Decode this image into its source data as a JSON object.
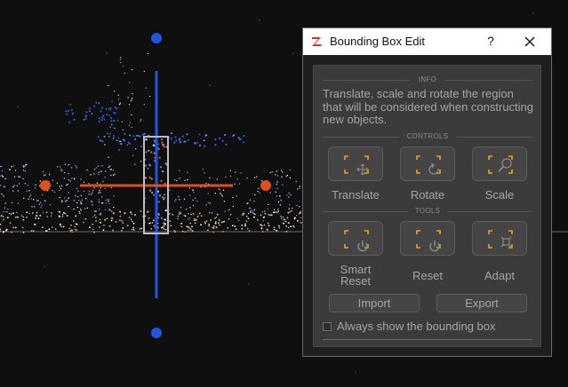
{
  "window": {
    "title": "Bounding Box Edit",
    "help_label": "?"
  },
  "info": {
    "header": "INFO",
    "text": "Translate, scale and rotate the region that will be considered when constructing new objects."
  },
  "controls": {
    "header": "CONTROLS",
    "buttons": [
      {
        "label": "Translate",
        "icon": "move-icon"
      },
      {
        "label": "Rotate",
        "icon": "rotate-icon"
      },
      {
        "label": "Scale",
        "icon": "magnifier-icon"
      }
    ]
  },
  "tools": {
    "header": "TOOLS",
    "buttons": [
      {
        "label": "Smart Reset",
        "icon": "power-icon"
      },
      {
        "label": "Reset",
        "icon": "power-icon"
      },
      {
        "label": "Adapt",
        "icon": "adapt-icon"
      }
    ],
    "import_label": "Import",
    "export_label": "Export"
  },
  "options": {
    "always_show_label": "Always show the bounding box",
    "always_show_checked": false
  },
  "colors": {
    "accent": "#f0a020",
    "gizmo_blue": "#2255dd",
    "gizmo_orange": "#e0501a"
  }
}
